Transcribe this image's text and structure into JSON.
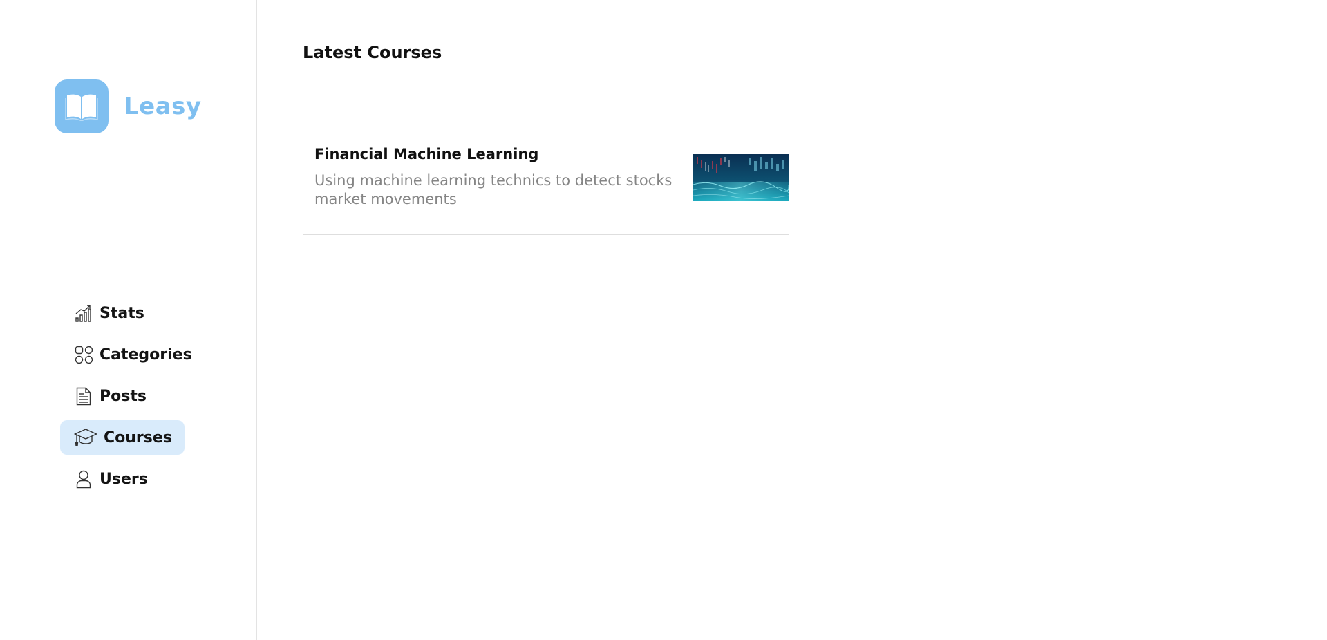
{
  "brand": {
    "name": "Leasy",
    "logo_icon": "open-book-icon",
    "color": "#7fbff0"
  },
  "sidebar": {
    "items": [
      {
        "label": "Stats",
        "icon": "stats-chart-icon",
        "active": false
      },
      {
        "label": "Categories",
        "icon": "categories-grid-icon",
        "active": false
      },
      {
        "label": "Posts",
        "icon": "document-icon",
        "active": false
      },
      {
        "label": "Courses",
        "icon": "graduation-cap-icon",
        "active": true
      },
      {
        "label": "Users",
        "icon": "user-icon",
        "active": false
      }
    ],
    "active_bg": "#d9ebfb"
  },
  "main": {
    "title": "Latest Courses",
    "courses": [
      {
        "title": "Financial Machine Learning",
        "description": "Using machine learning technics to detect stocks market movements",
        "thumbnail": "stock-market-thumbnail"
      }
    ]
  }
}
